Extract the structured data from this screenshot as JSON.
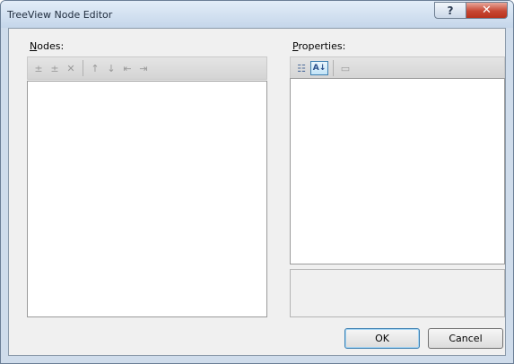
{
  "window": {
    "title": "TreeView Node Editor",
    "help_glyph": "?",
    "close_glyph": "✕"
  },
  "nodes": {
    "label_mnemonic": "N",
    "label_rest": "odes:",
    "toolbar": [
      {
        "name": "add-root-icon",
        "glyph": "±"
      },
      {
        "name": "add-child-icon",
        "glyph": "±"
      },
      {
        "name": "delete-icon",
        "glyph": "✕"
      },
      {
        "name": "move-up-icon",
        "glyph": "↑"
      },
      {
        "name": "move-down-icon",
        "glyph": "↓"
      },
      {
        "name": "move-left-icon",
        "glyph": "⇤"
      },
      {
        "name": "move-right-icon",
        "glyph": "⇥"
      }
    ]
  },
  "properties": {
    "label_mnemonic": "P",
    "label_rest": "roperties:",
    "toolbar": [
      {
        "name": "categorized-icon",
        "glyph": "☷"
      },
      {
        "name": "alphabetical-icon",
        "glyph": "A↓"
      },
      {
        "name": "property-pages-icon",
        "glyph": "▭"
      }
    ]
  },
  "buttons": {
    "ok": "OK",
    "cancel": "Cancel"
  }
}
